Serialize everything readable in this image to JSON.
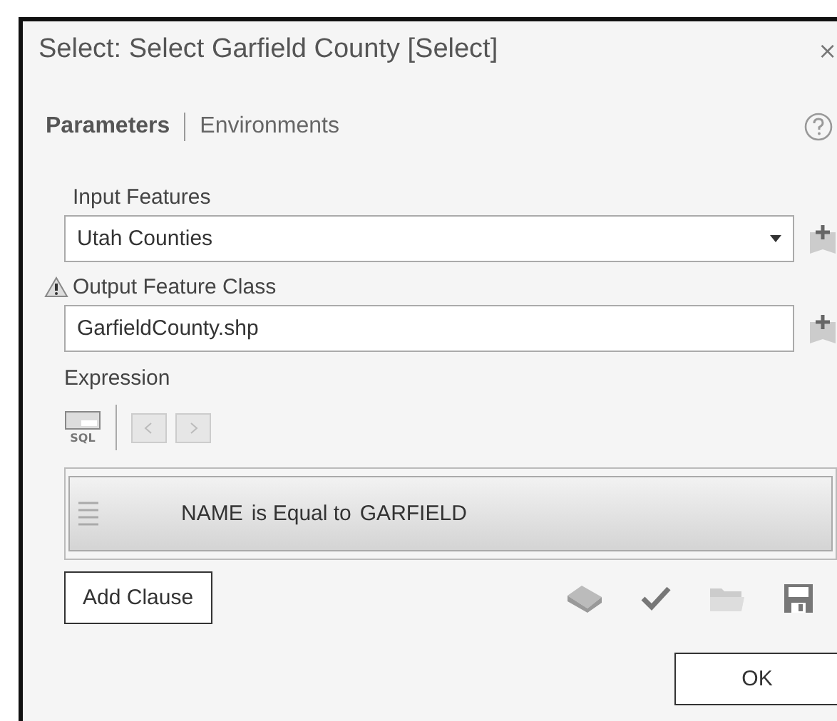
{
  "window": {
    "title": "Select: Select Garfield County [Select]",
    "close": "×"
  },
  "tabs": [
    {
      "label": "Parameters",
      "selected": true
    },
    {
      "label": "Environments",
      "selected": false
    }
  ],
  "parameters": [
    {
      "kind": "dropdown",
      "label": "Input Features",
      "value": "Utah Counties",
      "warning": false
    },
    {
      "kind": "text",
      "label": "Output Feature Class",
      "value": "GarfieldCounty.shp",
      "warning": true
    }
  ],
  "expression": {
    "label": "Expression",
    "sql_icon_label": "SQL",
    "clauses": [
      {
        "field": "NAME",
        "operator": "is Equal to",
        "value": "GARFIELD"
      }
    ],
    "add_clause": "Add Clause"
  },
  "buttons": [
    "OK"
  ]
}
